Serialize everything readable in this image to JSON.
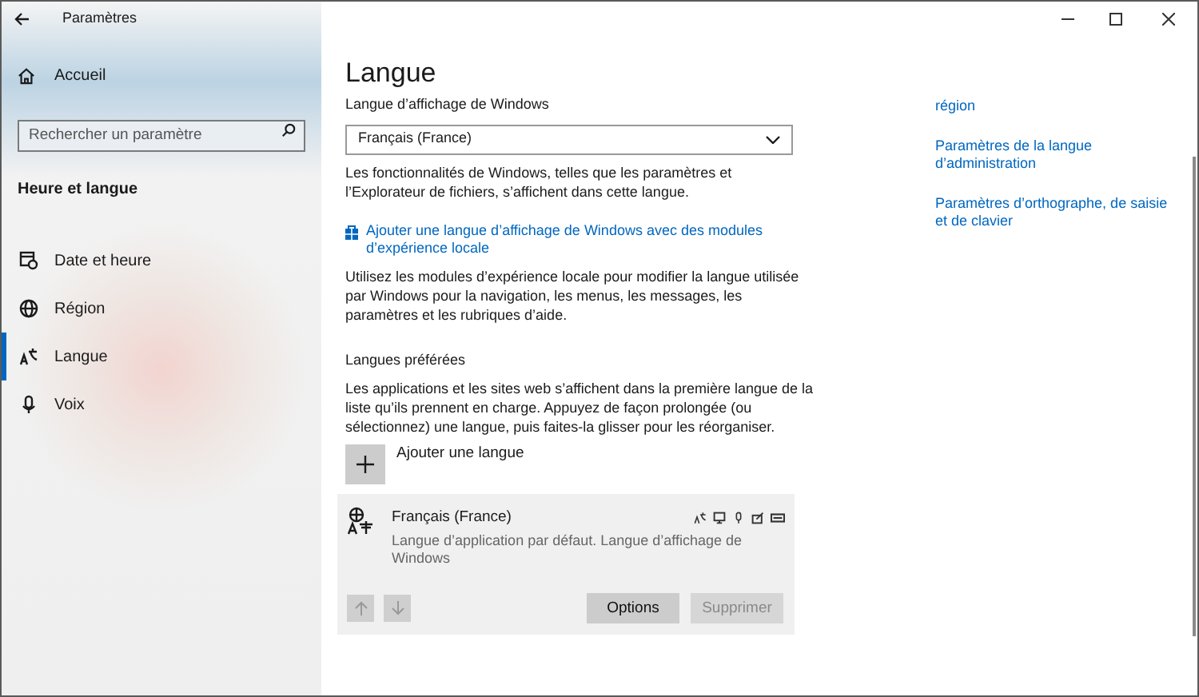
{
  "window": {
    "title": "Paramètres"
  },
  "sidebar": {
    "home": "Accueil",
    "search": {
      "placeholder": "Rechercher un paramètre"
    },
    "section": "Heure et langue",
    "items": [
      {
        "kind": "clock",
        "label": "Date et heure",
        "selected": false
      },
      {
        "kind": "globe",
        "label": "Région",
        "selected": false
      },
      {
        "kind": "language",
        "label": "Langue",
        "selected": true
      },
      {
        "kind": "mic",
        "label": "Voix",
        "selected": false
      }
    ]
  },
  "main": {
    "title": "Langue",
    "display_language": {
      "label": "Langue d’affichage de Windows",
      "value": "Français (France)",
      "description": "Les fonctionnalités de Windows, telles que les paramètres et l’Explorateur de fichiers, s’affichent dans cette langue."
    },
    "store_link": "Ajouter une langue d’affichage de Windows avec des modules d’expérience locale",
    "store_description": "Utilisez les modules d’expérience locale pour modifier la langue utilisée par Windows pour la navigation, les menus, les messages, les paramètres et les rubriques d’aide.",
    "preferred": {
      "heading": "Langues préférées",
      "description": "Les applications et les sites web s’affichent dans la première langue de la liste qu’ils prennent en charge. Appuyez de façon prolongée (ou sélectionnez) une langue, puis faites-la glisser pour les réorganiser.",
      "add": "Ajouter une langue",
      "languages": [
        {
          "name": "Français (France)",
          "detail": "Langue d’application par défaut. Langue d’affichage de Windows",
          "selected": true,
          "buttons": [
            {
              "label": "Options",
              "disabled": false
            },
            {
              "label": "Supprimer",
              "disabled": true
            }
          ]
        }
      ]
    }
  },
  "related_links": [
    "région",
    "Paramètres de la langue d’administration",
    "Paramètres d’orthographe, de saisie et de clavier"
  ]
}
